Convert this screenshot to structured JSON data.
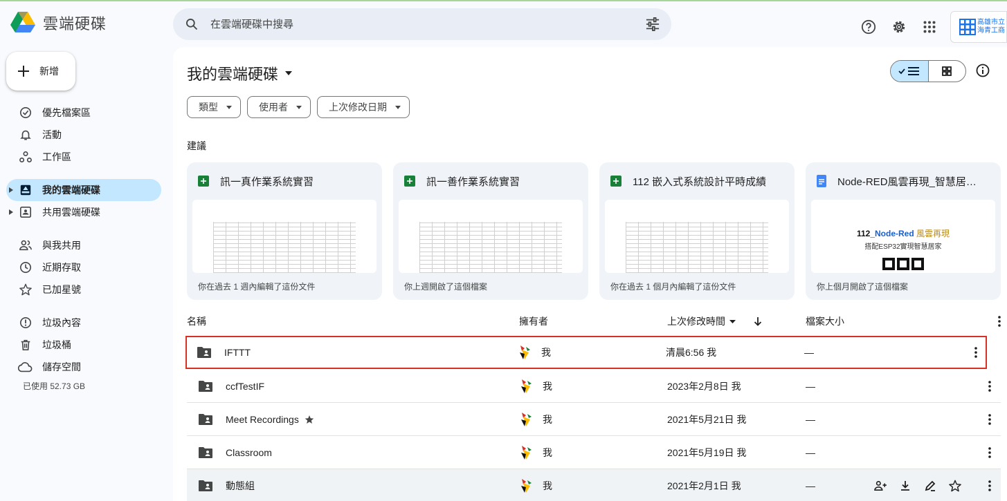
{
  "app": {
    "title": "雲端硬碟"
  },
  "search": {
    "placeholder": "在雲端硬碟中搜尋"
  },
  "org": {
    "line1": "高雄市立",
    "line2": "海青工商"
  },
  "new_button": {
    "label": "新增"
  },
  "nav": [
    {
      "id": "priority",
      "label": "優先檔案區",
      "icon": "check-circle-icon"
    },
    {
      "id": "activity",
      "label": "活動",
      "icon": "bell-icon"
    },
    {
      "id": "workspaces",
      "label": "工作區",
      "icon": "workspaces-icon"
    },
    {
      "id": "my-drive",
      "label": "我的雲端硬碟",
      "icon": "my-drive-icon",
      "active": true
    },
    {
      "id": "shared-drives",
      "label": "共用雲端硬碟",
      "icon": "shared-drive-icon"
    },
    {
      "id": "shared-with-me",
      "label": "與我共用",
      "icon": "people-icon"
    },
    {
      "id": "recent",
      "label": "近期存取",
      "icon": "clock-icon"
    },
    {
      "id": "starred",
      "label": "已加星號",
      "icon": "star-icon"
    },
    {
      "id": "spam",
      "label": "垃圾內容",
      "icon": "spam-icon"
    },
    {
      "id": "trash",
      "label": "垃圾桶",
      "icon": "trash-icon"
    },
    {
      "id": "storage",
      "label": "儲存空間",
      "icon": "cloud-icon"
    }
  ],
  "storage": {
    "used": "已使用 52.73 GB"
  },
  "main": {
    "title": "我的雲端硬碟",
    "filters": [
      "類型",
      "使用者",
      "上次修改日期"
    ],
    "suggested_label": "建議",
    "cards": [
      {
        "type": "sheet",
        "title": "訊一真作業系統實習",
        "footer": "你在過去 1 週內編輯了這份文件"
      },
      {
        "type": "sheet",
        "title": "訊一善作業系統實習",
        "footer": "你上週開啟了這個檔案"
      },
      {
        "type": "sheet",
        "title": "112 嵌入式系統設計平時成績",
        "footer": "你在過去 1 個月內編輯了這份文件"
      },
      {
        "type": "doc",
        "title": "Node-RED風雲再現_智慧居家...",
        "footer": "你上個月開啟了這個檔案"
      }
    ],
    "doc_preview": {
      "num": "112_",
      "name": "Node-Red",
      "tail": " 風雲再現",
      "sub": "搭配ESP32實現智慧居家"
    },
    "columns": {
      "name": "名稱",
      "owner": "擁有者",
      "modified": "上次修改時間",
      "size": "檔案大小"
    },
    "rows": [
      {
        "name": "IFTTT",
        "owner": "我",
        "modified": "清晨6:56 我",
        "size": "—",
        "highlight": true
      },
      {
        "name": "ccfTestIF",
        "owner": "我",
        "modified": "2023年2月8日 我",
        "size": "—"
      },
      {
        "name": "Meet Recordings",
        "owner": "我",
        "modified": "2021年5月21日 我",
        "size": "—",
        "starred": true
      },
      {
        "name": "Classroom",
        "owner": "我",
        "modified": "2021年5月19日 我",
        "size": "—"
      },
      {
        "name": "動態組",
        "owner": "我",
        "modified": "2021年2月1日 我",
        "size": "—",
        "hover": true
      }
    ]
  },
  "colors": {
    "accent": "#c2e7ff",
    "highlight_border": "#d93025",
    "sheets_green": "#188038",
    "docs_blue": "#4285f4"
  }
}
